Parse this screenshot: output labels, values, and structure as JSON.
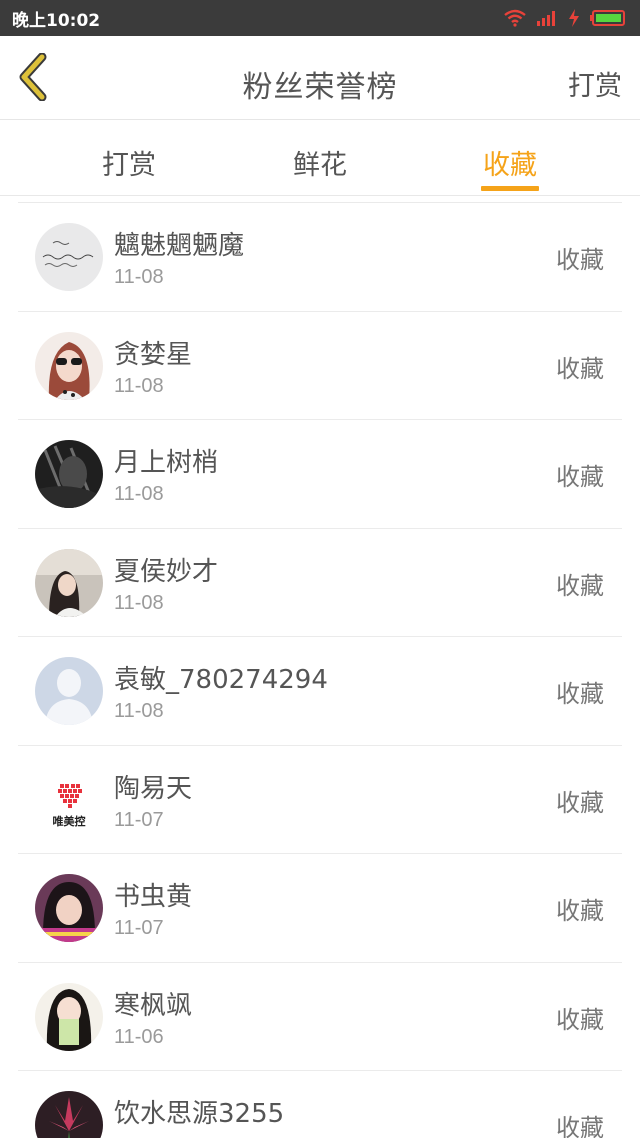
{
  "status_bar": {
    "time": "晚上10:02",
    "icons": [
      "wifi-icon",
      "signal-icon",
      "charging-icon",
      "battery-icon"
    ],
    "battery_color": "#57d63f",
    "accent_red": "#e8423a"
  },
  "header": {
    "back_icon": "chevron-left-icon",
    "back_color": "#ddc13a",
    "title": "粉丝荣誉榜",
    "right_action": "打赏"
  },
  "tabs": [
    {
      "label": "打赏",
      "active": false
    },
    {
      "label": "鲜花",
      "active": false
    },
    {
      "label": "收藏",
      "active": true
    }
  ],
  "accent_color": "#f5a319",
  "list": [
    {
      "name": "魑魅魍魉魔",
      "date": "11-08",
      "action": "收藏",
      "avatar": "handwriting-photo"
    },
    {
      "name": "贪婪星",
      "date": "11-08",
      "action": "收藏",
      "avatar": "girl-sunglasses-photo"
    },
    {
      "name": "月上树梢",
      "date": "11-08",
      "action": "收藏",
      "avatar": "dark-bw-photo"
    },
    {
      "name": "夏侯妙才",
      "date": "11-08",
      "action": "收藏",
      "avatar": "girl-window-photo"
    },
    {
      "name": "袁敏_780274294",
      "date": "11-08",
      "action": "收藏",
      "avatar": "default-person-icon"
    },
    {
      "name": "陶易天",
      "date": "11-07",
      "action": "收藏",
      "avatar": "heart-logo",
      "avatar_text": "唯美控"
    },
    {
      "name": "书虫黄",
      "date": "11-07",
      "action": "收藏",
      "avatar": "girl-portrait-photo"
    },
    {
      "name": "寒枫飒",
      "date": "11-06",
      "action": "收藏",
      "avatar": "girl-book-photo"
    },
    {
      "name": "饮水思源3255",
      "date": "",
      "action": "收藏",
      "avatar": "flower-photo"
    }
  ]
}
